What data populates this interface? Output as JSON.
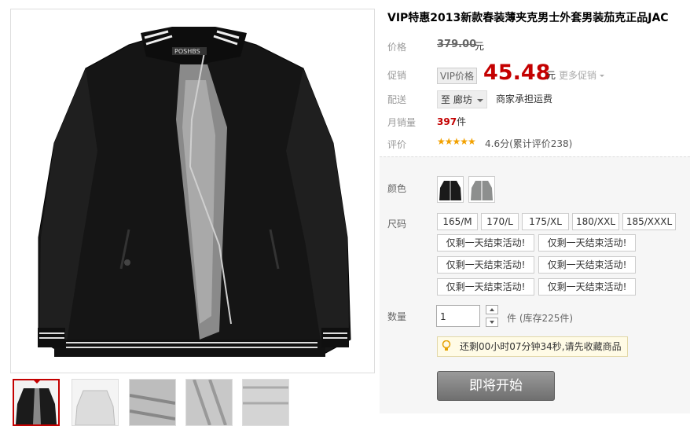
{
  "product": {
    "title": "VIP特惠2013新款春装薄夹克男士外套男装茄克正品JAC",
    "main_image_brand": "POSHBS"
  },
  "labels": {
    "price": "价格",
    "promo": "促销",
    "shipping": "配送",
    "monthly_sales": "月销量",
    "rating": "评价",
    "color": "颜色",
    "size": "尺码",
    "quantity": "数量"
  },
  "price": {
    "original": "379.00",
    "original_unit": "元",
    "vip_tag": "VIP价格",
    "current": "45.48",
    "current_unit": "元",
    "more_promos": "更多促销"
  },
  "shipping": {
    "location": "至 廊坊",
    "freight": "商家承担运费"
  },
  "sales": {
    "count": "397",
    "unit": "件"
  },
  "rating": {
    "stars": "★★★★★",
    "score_text": "4.6分(累计评价238)",
    "stars_value": 4.6
  },
  "colors": [
    {
      "name": "black",
      "swatch": "#1a1a1a"
    },
    {
      "name": "gray",
      "swatch": "#8d8f8e"
    }
  ],
  "sizes": [
    "165/M",
    "170/L",
    "175/XL",
    "180/XXL",
    "185/XXXL"
  ],
  "promo_options": [
    "仅剩一天结束活动!",
    "仅剩一天结束活动!",
    "仅剩一天结束活动!",
    "仅剩一天结束活动!",
    "仅剩一天结束活动!",
    "仅剩一天结束活动!"
  ],
  "quantity": {
    "value": "1",
    "stock": "件 (库存225件)"
  },
  "tip": {
    "text": "还剩00小时07分钟34秒,请先收藏商品"
  },
  "buy_button": "即将开始",
  "colors_theme": {
    "price_red": "#c40000",
    "star_orange": "#f2a100",
    "panel_bg": "#f6f6f6",
    "button_gray": "#7f7f7f"
  }
}
